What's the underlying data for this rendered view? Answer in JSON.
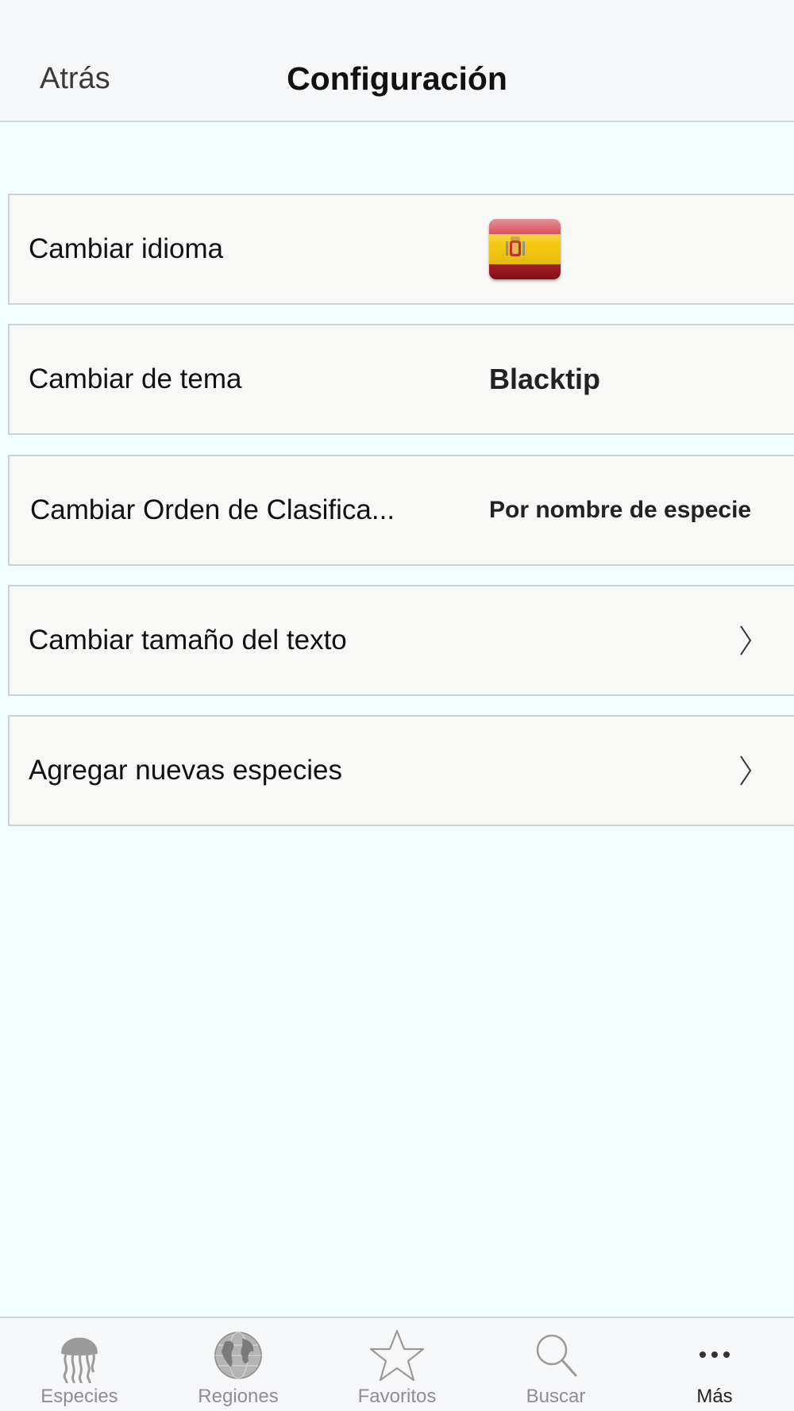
{
  "nav": {
    "back_label": "Atrás",
    "title": "Configuración"
  },
  "settings": [
    {
      "label": "Cambiar idioma",
      "value_type": "flag",
      "icon": "spain-flag-icon"
    },
    {
      "label": "Cambiar de tema",
      "value": "Blacktip"
    },
    {
      "label": "Cambiar Orden de Clasifica...",
      "value": "Por nombre de especie"
    },
    {
      "label": "Cambiar tamaño del texto",
      "icon": "chevron-right-icon"
    },
    {
      "label": "Agregar nuevas especies",
      "icon": "chevron-right-icon"
    }
  ],
  "tabs": [
    {
      "label": "Especies",
      "icon": "jellyfish-icon",
      "active": false
    },
    {
      "label": "Regiones",
      "icon": "globe-icon",
      "active": false
    },
    {
      "label": "Favoritos",
      "icon": "star-icon",
      "active": false
    },
    {
      "label": "Buscar",
      "icon": "search-icon",
      "active": false
    },
    {
      "label": "Más",
      "icon": "more-dots-icon",
      "active": true
    }
  ],
  "colors": {
    "background": "#f3fefe",
    "bar_background": "#f6f7f8",
    "row_background": "#f8f8f6",
    "tab_inactive": "#8e8e93",
    "tab_active": "#222222"
  }
}
